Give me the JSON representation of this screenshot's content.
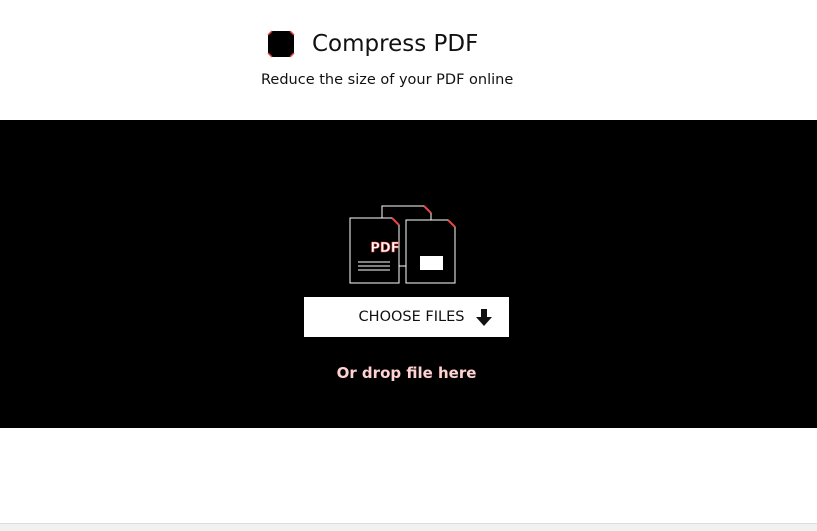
{
  "header": {
    "icon": "compress-tool-icon",
    "title": "Compress PDF",
    "subtitle": "Reduce the size of your PDF online"
  },
  "upload": {
    "illustration_icon": "pdf-files-icon",
    "illustration_label": "PDF",
    "choose_button_label": "CHOOSE FILES",
    "choose_button_icon": "arrow-down-icon",
    "drop_text": "Or drop file here"
  },
  "colors": {
    "upload_background": "#000000",
    "button_background": "#ffffff",
    "accent": "#e5473f",
    "drop_text": "#ffd2d2"
  }
}
